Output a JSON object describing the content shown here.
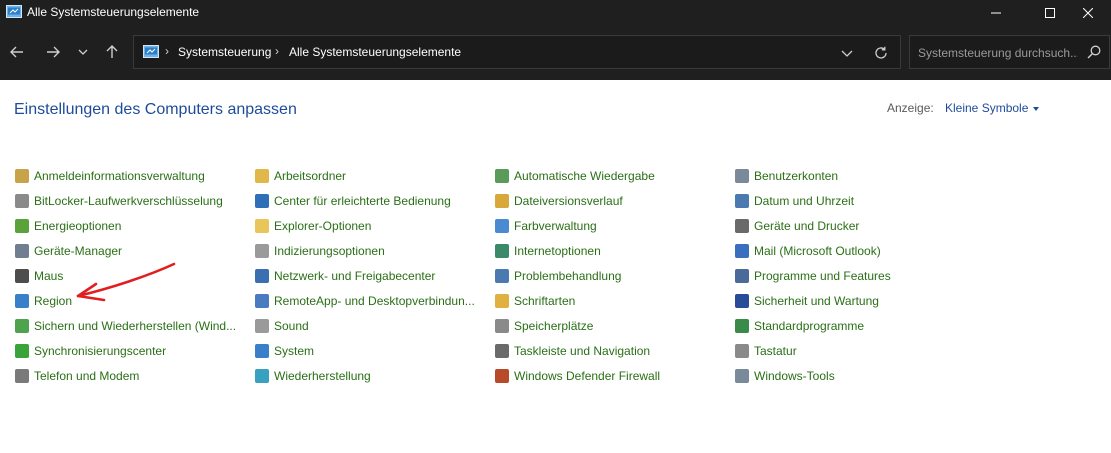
{
  "window": {
    "title": "Alle Systemsteuerungselemente"
  },
  "nav": {
    "breadcrumb": [
      "Systemsteuerung",
      "Alle Systemsteuerungselemente"
    ],
    "search_placeholder": "Systemsteuerung durchsuch..."
  },
  "content": {
    "heading": "Einstellungen des Computers anpassen",
    "view_label": "Anzeige:",
    "view_value": "Kleine Symbole"
  },
  "columns": [
    [
      {
        "label": "Anmeldeinformationsverwaltung",
        "icon": "credential-icon",
        "color": "#c9a34a"
      },
      {
        "label": "BitLocker-Laufwerkverschlüsselung",
        "icon": "bitlocker-icon",
        "color": "#8a8a8a"
      },
      {
        "label": "Energieoptionen",
        "icon": "power-icon",
        "color": "#5aa33a"
      },
      {
        "label": "Geräte-Manager",
        "icon": "device-manager-icon",
        "color": "#6f7f8f"
      },
      {
        "label": "Maus",
        "icon": "mouse-icon",
        "color": "#4d4d4d"
      },
      {
        "label": "Region",
        "icon": "globe-icon",
        "color": "#3a7fc9"
      },
      {
        "label": "Sichern und Wiederherstellen (Wind...",
        "icon": "backup-icon",
        "color": "#4fa34f"
      },
      {
        "label": "Synchronisierungscenter",
        "icon": "sync-icon",
        "color": "#3aa33a"
      },
      {
        "label": "Telefon und Modem",
        "icon": "phone-icon",
        "color": "#7a7a7a"
      }
    ],
    [
      {
        "label": "Arbeitsordner",
        "icon": "work-folder-icon",
        "color": "#e0b84a"
      },
      {
        "label": "Center für erleichterte Bedienung",
        "icon": "accessibility-icon",
        "color": "#2f6fb8"
      },
      {
        "label": "Explorer-Optionen",
        "icon": "folder-options-icon",
        "color": "#e8c65a"
      },
      {
        "label": "Indizierungsoptionen",
        "icon": "indexing-icon",
        "color": "#9a9a9a"
      },
      {
        "label": "Netzwerk- und Freigabecenter",
        "icon": "network-icon",
        "color": "#3a6fb0"
      },
      {
        "label": "RemoteApp- und Desktopverbindun...",
        "icon": "remoteapp-icon",
        "color": "#4a7ac0"
      },
      {
        "label": "Sound",
        "icon": "sound-icon",
        "color": "#9a9a9a"
      },
      {
        "label": "System",
        "icon": "system-icon",
        "color": "#3a80c8"
      },
      {
        "label": "Wiederherstellung",
        "icon": "recovery-icon",
        "color": "#3aa0c0"
      }
    ],
    [
      {
        "label": "Automatische Wiedergabe",
        "icon": "autoplay-icon",
        "color": "#5a9a5a"
      },
      {
        "label": "Dateiversionsverlauf",
        "icon": "file-history-icon",
        "color": "#d8a83a"
      },
      {
        "label": "Farbverwaltung",
        "icon": "color-management-icon",
        "color": "#4a8ad0"
      },
      {
        "label": "Internetoptionen",
        "icon": "internet-options-icon",
        "color": "#3a8a6a"
      },
      {
        "label": "Problembehandlung",
        "icon": "troubleshoot-icon",
        "color": "#4a7ab0"
      },
      {
        "label": "Schriftarten",
        "icon": "fonts-icon",
        "color": "#e0b040"
      },
      {
        "label": "Speicherplätze",
        "icon": "storage-icon",
        "color": "#8a8a8a"
      },
      {
        "label": "Taskleiste und Navigation",
        "icon": "taskbar-icon",
        "color": "#6a6a6a"
      },
      {
        "label": "Windows Defender Firewall",
        "icon": "firewall-icon",
        "color": "#b84a2a"
      }
    ],
    [
      {
        "label": "Benutzerkonten",
        "icon": "user-accounts-icon",
        "color": "#7a8a9a"
      },
      {
        "label": "Datum und Uhrzeit",
        "icon": "clock-icon",
        "color": "#4a7ab0"
      },
      {
        "label": "Geräte und Drucker",
        "icon": "printer-icon",
        "color": "#6a6a6a"
      },
      {
        "label": "Mail (Microsoft Outlook)",
        "icon": "mail-icon",
        "color": "#3a6fc0"
      },
      {
        "label": "Programme und Features",
        "icon": "programs-icon",
        "color": "#4a6a9a"
      },
      {
        "label": "Sicherheit und Wartung",
        "icon": "flag-icon",
        "color": "#2a4a9a"
      },
      {
        "label": "Standardprogramme",
        "icon": "default-programs-icon",
        "color": "#3a8a4a"
      },
      {
        "label": "Tastatur",
        "icon": "keyboard-icon",
        "color": "#8a8a8a"
      },
      {
        "label": "Windows-Tools",
        "icon": "windows-tools-icon",
        "color": "#7a8a9a"
      }
    ]
  ]
}
